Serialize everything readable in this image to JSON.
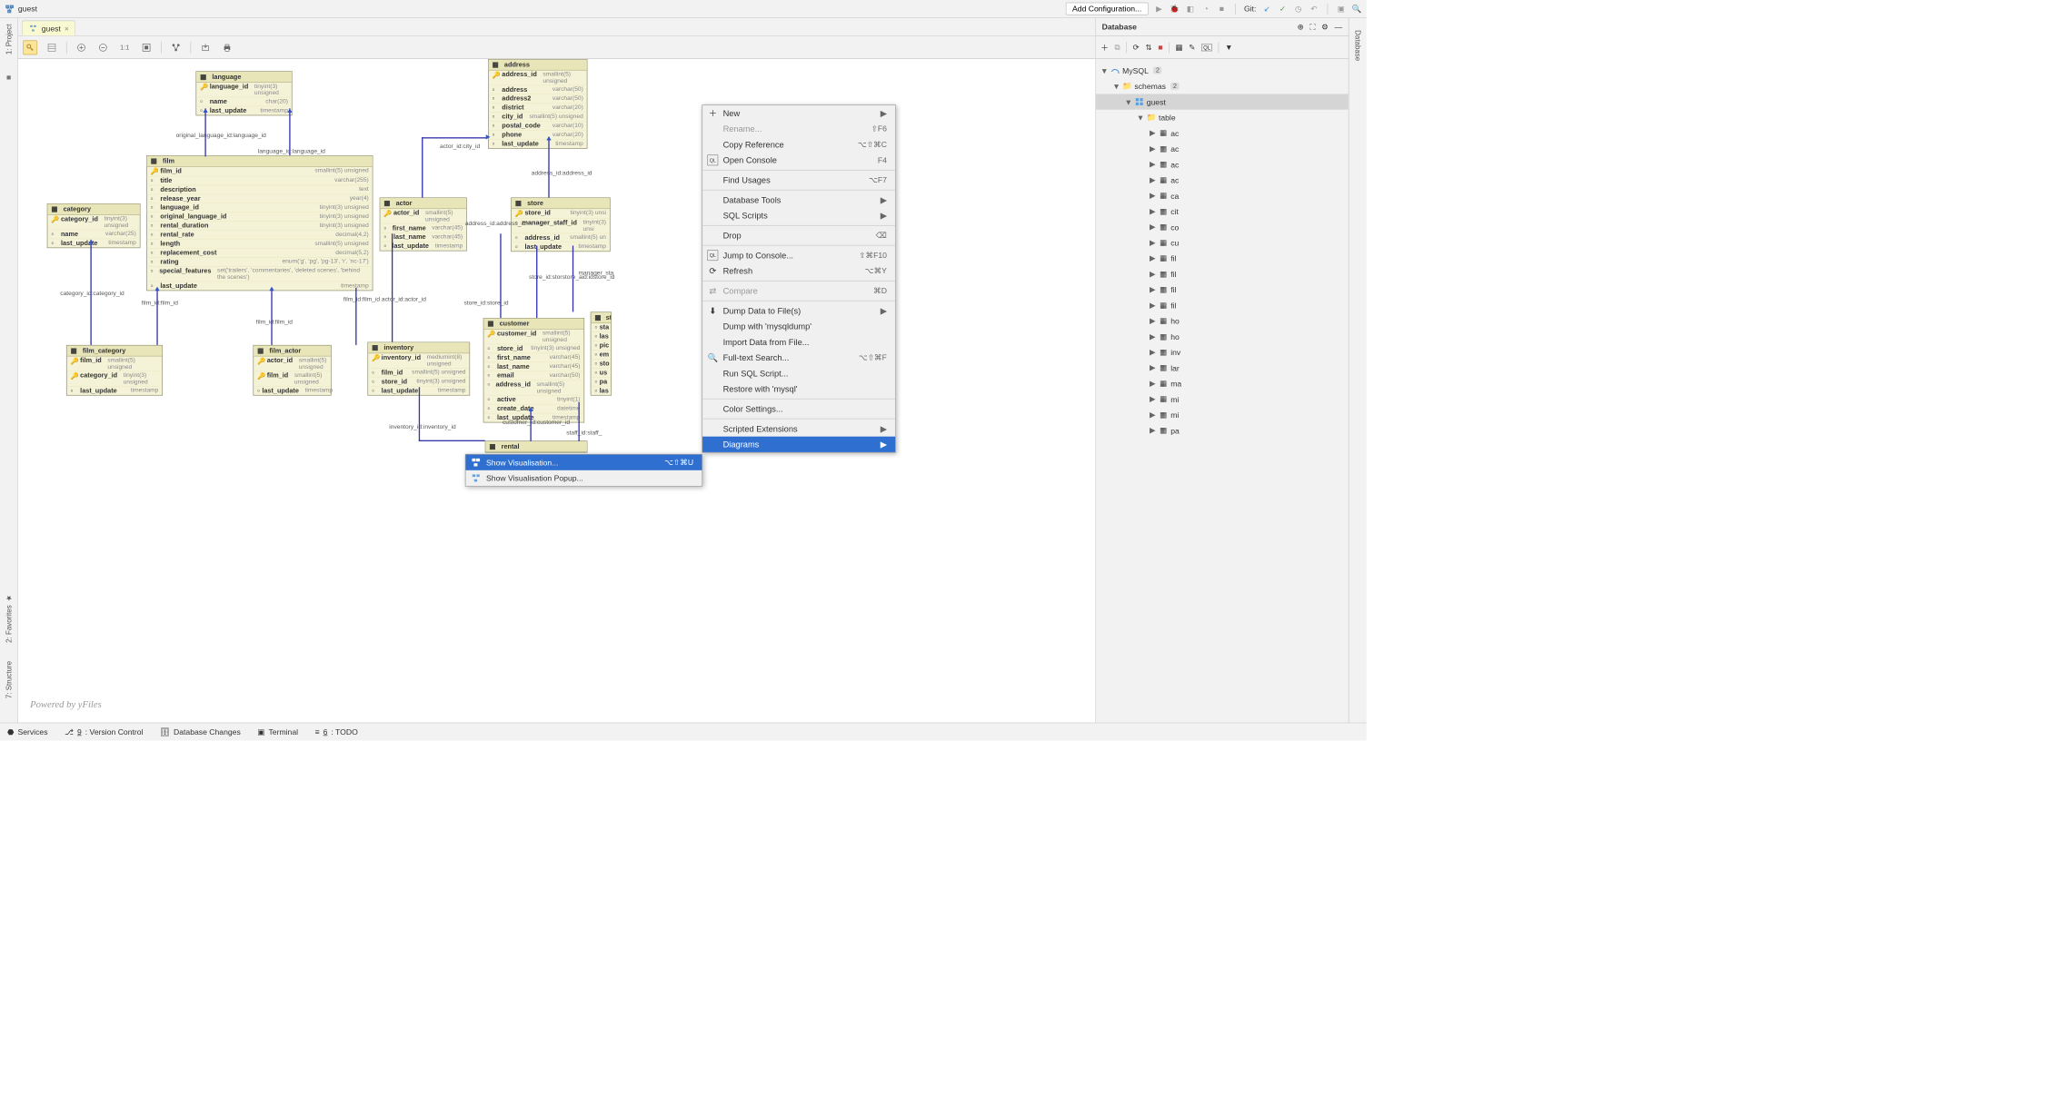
{
  "breadcrumb": {
    "label": "guest"
  },
  "toolbar": {
    "add_config": "Add Configuration...",
    "git_label": "Git:"
  },
  "tab": {
    "label": "guest"
  },
  "watermark": "Powered by yFiles",
  "db_panel": {
    "title": "Database",
    "datasource": "MySQL",
    "ds_badge": "2",
    "schemas_label": "schemas",
    "schemas_badge": "2",
    "guest_label": "guest",
    "tables_label": "table",
    "tables": [
      "ac",
      "ac",
      "ac",
      "ac",
      "ca",
      "cit",
      "co",
      "cu",
      "fil",
      "fil",
      "fil",
      "fil",
      "ho",
      "ho",
      "inv",
      "lar",
      "ma",
      "mi",
      "mi",
      "pa"
    ]
  },
  "context_menu": {
    "new": "New",
    "rename": "Rename...",
    "rename_sc": "⇧F6",
    "copy_ref": "Copy Reference",
    "copy_ref_sc": "⌥⇧⌘C",
    "open_console": "Open Console",
    "open_console_sc": "F4",
    "find_usages": "Find Usages",
    "find_usages_sc": "⌥F7",
    "db_tools": "Database Tools",
    "sql_scripts": "SQL Scripts",
    "drop": "Drop",
    "jump_console": "Jump to Console...",
    "jump_console_sc": "⇧⌘F10",
    "refresh": "Refresh",
    "refresh_sc": "⌥⌘Y",
    "compare": "Compare",
    "compare_sc": "⌘D",
    "dump_data": "Dump Data to File(s)",
    "dump_mysqldump": "Dump with 'mysqldump'",
    "import_data": "Import Data from File...",
    "fulltext": "Full-text Search...",
    "fulltext_sc": "⌥⇧⌘F",
    "run_sql": "Run SQL Script...",
    "restore": "Restore with 'mysql'",
    "color_settings": "Color Settings...",
    "scripted_ext": "Scripted Extensions",
    "diagrams": "Diagrams"
  },
  "submenu": {
    "show_vis": "Show Visualisation...",
    "show_vis_sc": "⌥⇧⌘U",
    "show_vis_popup": "Show Visualisation Popup..."
  },
  "bottom": {
    "services": "Services",
    "vcs": ": Version Control",
    "vcs_num": "9",
    "db_changes": "Database Changes",
    "terminal": "Terminal",
    "todo": ": TODO",
    "todo_num": "6"
  },
  "rails": {
    "project": "1: Project",
    "favorites": "2: Favorites",
    "structure": "7: Structure",
    "database": "Database"
  },
  "er": {
    "language": {
      "title": "language",
      "cols": [
        {
          "n": "language_id",
          "t": "tinyint(3) unsigned",
          "k": true
        },
        {
          "n": "name",
          "t": "char(20)"
        },
        {
          "n": "last_update",
          "t": "timestamp"
        }
      ]
    },
    "category": {
      "title": "category",
      "cols": [
        {
          "n": "category_id",
          "t": "tinyint(3) unsigned",
          "k": true
        },
        {
          "n": "name",
          "t": "varchar(25)"
        },
        {
          "n": "last_update",
          "t": "timestamp"
        }
      ]
    },
    "film": {
      "title": "film",
      "cols": [
        {
          "n": "film_id",
          "t": "smallint(5) unsigned",
          "k": true
        },
        {
          "n": "title",
          "t": "varchar(255)"
        },
        {
          "n": "description",
          "t": "text"
        },
        {
          "n": "release_year",
          "t": "year(4)"
        },
        {
          "n": "language_id",
          "t": "tinyint(3) unsigned"
        },
        {
          "n": "original_language_id",
          "t": "tinyint(3) unsigned"
        },
        {
          "n": "rental_duration",
          "t": "tinyint(3) unsigned"
        },
        {
          "n": "rental_rate",
          "t": "decimal(4,2)"
        },
        {
          "n": "length",
          "t": "smallint(5) unsigned"
        },
        {
          "n": "replacement_cost",
          "t": "decimal(5,2)"
        },
        {
          "n": "rating",
          "t": "enum('g', 'pg', 'pg-13', 'r', 'nc-17')"
        },
        {
          "n": "special_features",
          "t": "set('trailers', 'commentaries', 'deleted scenes', 'behind the scenes')"
        },
        {
          "n": "last_update",
          "t": "timestamp"
        }
      ]
    },
    "actor": {
      "title": "actor",
      "cols": [
        {
          "n": "actor_id",
          "t": "smallint(5) unsigned",
          "k": true
        },
        {
          "n": "first_name",
          "t": "varchar(45)"
        },
        {
          "n": "last_name",
          "t": "varchar(45)"
        },
        {
          "n": "last_update",
          "t": "timestamp"
        }
      ]
    },
    "address": {
      "title": "address",
      "cols": [
        {
          "n": "address_id",
          "t": "smallint(5) unsigned",
          "k": true
        },
        {
          "n": "address",
          "t": "varchar(50)"
        },
        {
          "n": "address2",
          "t": "varchar(50)"
        },
        {
          "n": "district",
          "t": "varchar(20)"
        },
        {
          "n": "city_id",
          "t": "smallint(5) unsigned"
        },
        {
          "n": "postal_code",
          "t": "varchar(10)"
        },
        {
          "n": "phone",
          "t": "varchar(20)"
        },
        {
          "n": "last_update",
          "t": "timestamp"
        }
      ]
    },
    "store": {
      "title": "store",
      "cols": [
        {
          "n": "store_id",
          "t": "tinyint(3) unsi",
          "k": true
        },
        {
          "n": "manager_staff_id",
          "t": "tinyint(3) unsi"
        },
        {
          "n": "address_id",
          "t": "smallint(5) un"
        },
        {
          "n": "last_update",
          "t": "timestamp"
        }
      ]
    },
    "film_category": {
      "title": "film_category",
      "cols": [
        {
          "n": "film_id",
          "t": "smallint(5) unsigned",
          "k": true
        },
        {
          "n": "category_id",
          "t": "tinyint(3) unsigned",
          "k": true
        },
        {
          "n": "last_update",
          "t": "timestamp"
        }
      ]
    },
    "film_actor": {
      "title": "film_actor",
      "cols": [
        {
          "n": "actor_id",
          "t": "smallint(5) unsigned",
          "k": true
        },
        {
          "n": "film_id",
          "t": "smallint(5) unsigned",
          "k": true
        },
        {
          "n": "last_update",
          "t": "timestamp"
        }
      ]
    },
    "inventory": {
      "title": "inventory",
      "cols": [
        {
          "n": "inventory_id",
          "t": "mediumint(8) unsigned",
          "k": true
        },
        {
          "n": "film_id",
          "t": "smallint(5) unsigned"
        },
        {
          "n": "store_id",
          "t": "tinyint(3) unsigned"
        },
        {
          "n": "last_update",
          "t": "timestamp"
        }
      ]
    },
    "customer": {
      "title": "customer",
      "cols": [
        {
          "n": "customer_id",
          "t": "smallint(5) unsigned",
          "k": true
        },
        {
          "n": "store_id",
          "t": "tinyint(3) unsigned"
        },
        {
          "n": "first_name",
          "t": "varchar(45)"
        },
        {
          "n": "last_name",
          "t": "varchar(45)"
        },
        {
          "n": "email",
          "t": "varchar(50)"
        },
        {
          "n": "address_id",
          "t": "smallint(5) unsigned"
        },
        {
          "n": "active",
          "t": "tinyint(1)"
        },
        {
          "n": "create_date",
          "t": "datetime"
        },
        {
          "n": "last_update",
          "t": "timestamp"
        }
      ]
    },
    "rental": {
      "title": "rental",
      "cols": []
    },
    "staff_cut": {
      "title": "sta",
      "cols": [
        {
          "n": "sta",
          "t": ""
        },
        {
          "n": "las",
          "t": ""
        },
        {
          "n": "pic",
          "t": ""
        },
        {
          "n": "em",
          "t": ""
        },
        {
          "n": "sto",
          "t": ""
        },
        {
          "n": "us",
          "t": ""
        },
        {
          "n": "pa",
          "t": ""
        },
        {
          "n": "las",
          "t": ""
        }
      ]
    },
    "labels": {
      "orig_lang": "original_language_id:language_id",
      "lang": "language_id:language_id",
      "cat": "category_id:category_id",
      "filmcat_film": "film_id:film_id",
      "filmactor_film": "film_id:film_id",
      "filmactor_actor": "film_id:film_id   actor_id:actor_id",
      "actor_city": "actor_id:city_id",
      "addr": "address_id:address_id",
      "addr2": "address_id:address_id",
      "store": "store_id:store_id",
      "store2": "store_id:storstore_aid:idstore_id",
      "manager": "manager_sta",
      "inv": "inventory_id:inventory_id",
      "cust": "customer_id:customer_id",
      "staff": "staff_id:staff_"
    }
  }
}
